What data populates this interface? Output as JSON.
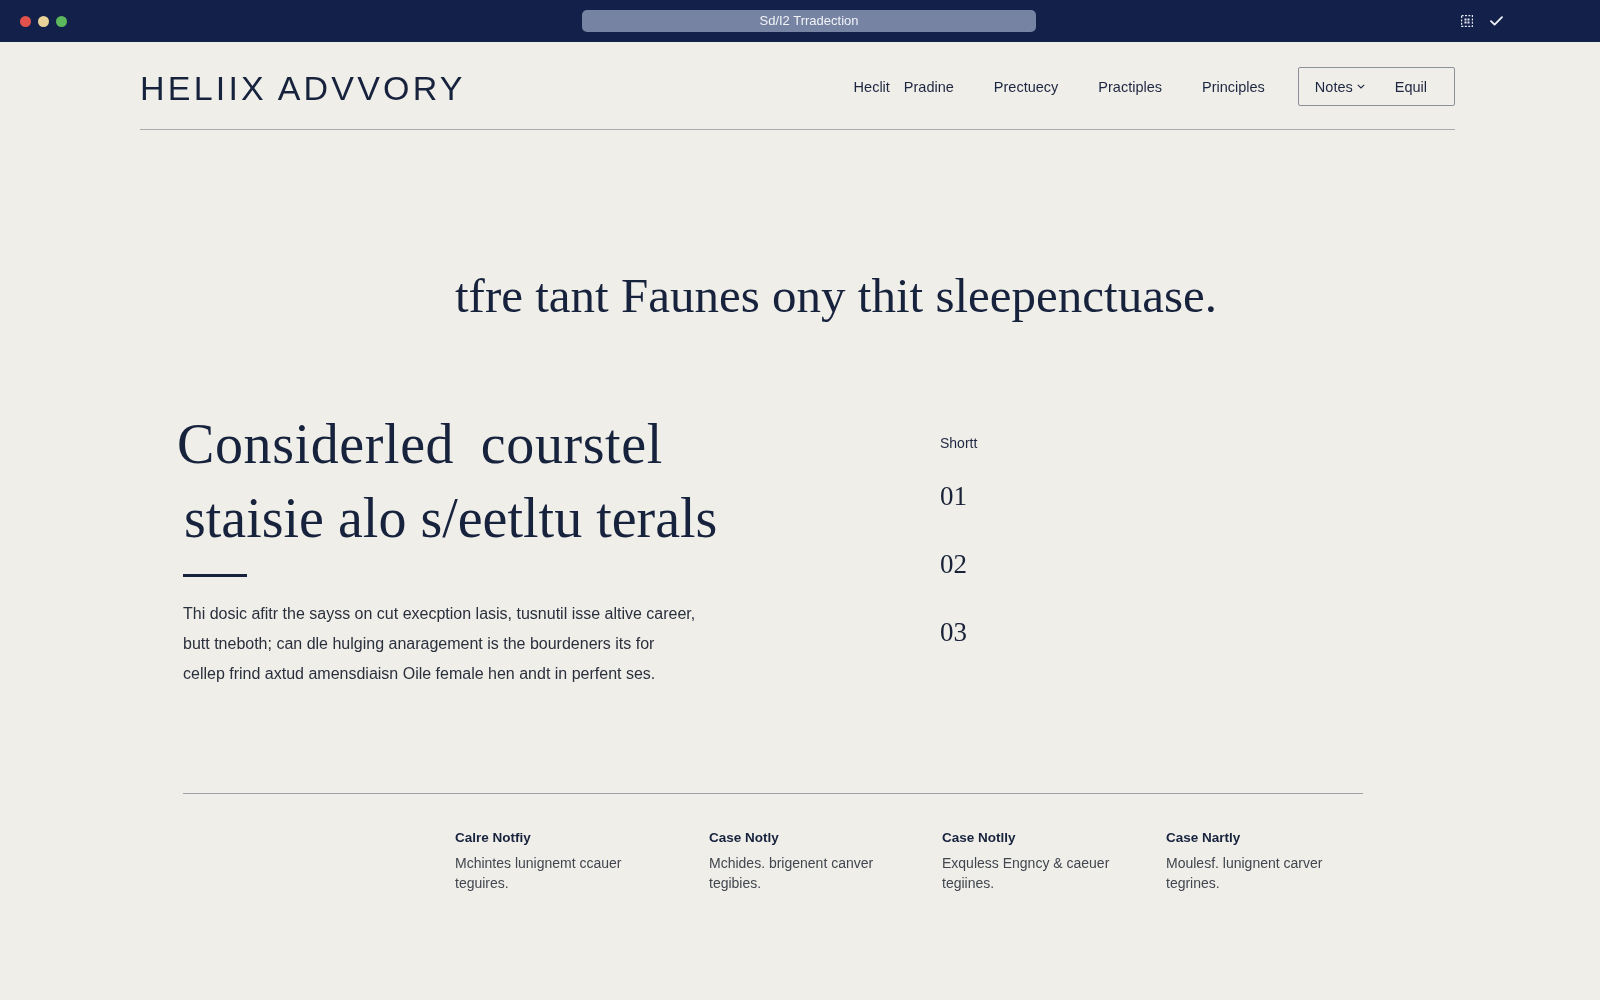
{
  "browser": {
    "address": "Sd/I2 Trradection"
  },
  "header": {
    "logo": "HELIIX ADVVORY",
    "nav": [
      "Heclit",
      "Pradine",
      "Prectuecy",
      "Practiples",
      "Principles"
    ],
    "menu_box": {
      "dropdown": "Notes",
      "link": "Equil"
    }
  },
  "tagline": "tfre tant Faunes ony thit sleepenctuase.",
  "intro": {
    "heading_lines": [
      "Considerled courstel",
      "staisie alo s/eetltu terals"
    ],
    "body": "Thi dosic afitr the sayss on cut execption lasis, tusnutil isse altive career, butt tneboth; can dle hulging anaragement is the bourdeners its for cellep frind axtud amensdiaisn Oile female hen andt in perfent ses."
  },
  "list": {
    "label": "Shortt",
    "numbers": [
      "01",
      "02",
      "03"
    ]
  },
  "cases": [
    {
      "title": "Calre Notfiy",
      "text": "Mchintes lunignemt ccauer teguires."
    },
    {
      "title": "Case Notly",
      "text": "Mchides. brigenent canver tegibies."
    },
    {
      "title": "Case Notlly",
      "text": "Exquless Engncy & caeuer tegiines."
    },
    {
      "title": "Case Nartly",
      "text": "Moulesf. lunignent carver tegrines."
    }
  ]
}
